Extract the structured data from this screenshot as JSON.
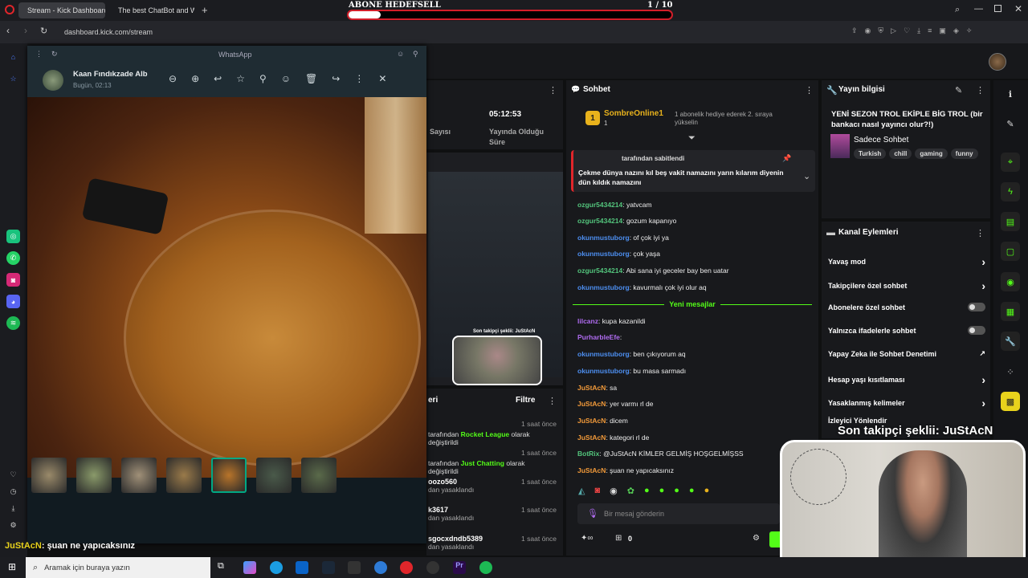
{
  "browser": {
    "tabs": [
      {
        "label": "Stream - Kick Dashboard"
      },
      {
        "label": "The best ChatBot and W"
      }
    ],
    "url": "dashboard.kick.com/stream",
    "goal": {
      "label": "ABONE HEDEFSELL",
      "progress_text": "1 / 10",
      "progress": 0.1
    }
  },
  "whatsapp": {
    "window_title": "WhatsApp",
    "contact_name": "Kaan Fındıkzade Alb",
    "timestamp": "Bugün, 02:13",
    "thumbnail_count": 7,
    "selected_thumbnail": 5
  },
  "stats": {
    "label_left": "Sayısı",
    "uptime": "05:12:53",
    "uptime_label": "Yayında Olduğu Süre"
  },
  "chat": {
    "title": "Sohbet",
    "top_gifter": "SombreOnline1",
    "top_gifter_count": "1",
    "gift_note": "1 abonelik hediye ederek 2. sıraya yükselin",
    "pinned_by": "tarafından sabitlendi",
    "pinned_message": "Çekme dünya nazını kıl beş vakit namazını yarın kılarım diyenin dün kıldık namazını",
    "new_messages_label": "Yeni mesajlar",
    "input_placeholder": "Bir mesaj gönderin",
    "footer_count": "0",
    "messages": [
      {
        "user": "ozgur5434214",
        "text": ": yatvcam",
        "color": "green"
      },
      {
        "user": "ozgur5434214",
        "text": ": gozum kapanıyo",
        "color": "green"
      },
      {
        "user": "okunmustuborg",
        "text": ": of çok iyi ya",
        "color": "blue"
      },
      {
        "user": "okunmustuborg",
        "text": ": çok yaşa",
        "color": "blue"
      },
      {
        "user": "ozgur5434214",
        "text": ": Abi sana iyi geceler bay ben uatar",
        "color": "green"
      },
      {
        "user": "okunmustuborg",
        "text": ": kavurmalı çok iyi olur aq",
        "color": "blue"
      },
      {
        "user": "lilcanz",
        "text": ": kupa kazanildi",
        "color": "purple"
      },
      {
        "user": "PurharbleEfe",
        "text": ":",
        "color": "purple"
      },
      {
        "user": "okunmustuborg",
        "text": ": ben çıkıyorum aq",
        "color": "blue"
      },
      {
        "user": "okunmustuborg",
        "text": ": bu masa sarmadı",
        "color": "blue"
      },
      {
        "user": "JuStAcN",
        "text": ": sa",
        "color": "orange"
      },
      {
        "user": "JuStAcN",
        "text": ": yer varmı rl de",
        "color": "orange"
      },
      {
        "user": "JuStAcN",
        "text": ": dicem",
        "color": "orange"
      },
      {
        "user": "JuStAcN",
        "text": ": kategori rl de",
        "color": "orange"
      },
      {
        "user": "BotRix",
        "text": ": @JuStAcN KİMLER GELMİŞ HOŞGELMİŞSS",
        "color": "green"
      },
      {
        "user": "JuStAcN",
        "text": ": şuan ne yapıcaksınız",
        "color": "orange"
      }
    ]
  },
  "events": {
    "header": "eri",
    "filter_label": "Filtre",
    "items": [
      {
        "prefix": "tarafından",
        "cat": "Rocket League",
        "suffix": "olarak değiştirildi",
        "time": "1 saat önce"
      },
      {
        "prefix": "tarafından",
        "cat": "Just Chatting",
        "suffix": "olarak değiştirildi",
        "time": "1 saat önce"
      },
      {
        "name": "oozo560",
        "sub": "dan yasaklandı",
        "time": "1 saat önce"
      },
      {
        "name": "k3617",
        "sub": "dan yasaklandı",
        "time": "1 saat önce"
      },
      {
        "name": "sgocxdndb5389",
        "sub": "dan yasaklandı",
        "time": "1 saat önce"
      }
    ]
  },
  "stream_info": {
    "title": "Yayın bilgisi",
    "stream_title": "YENİ SEZON TROL EKİPLE BİG TROL (bir bankacı nasıl yayıncı olur?!)",
    "category": "Sadece Sohbet",
    "tags": [
      "Turkish",
      "chill",
      "gaming",
      "funny"
    ]
  },
  "channel_actions": {
    "title": "Kanal Eylemleri",
    "items": [
      {
        "label": "Yavaş mod",
        "kind": "arrow"
      },
      {
        "label": "Takipçilere özel sohbet",
        "kind": "arrow"
      },
      {
        "label": "Abonelere özel sohbet",
        "kind": "toggle"
      },
      {
        "label": "Yalnızca ifadelerle sohbet",
        "kind": "toggle"
      },
      {
        "label": "Yapay Zeka ile Sohbet Denetimi",
        "kind": "link"
      },
      {
        "label": "Hesap yaşı kısıtlaması",
        "kind": "arrow"
      },
      {
        "label": "Yasaklanmış kelimeler",
        "kind": "arrow"
      },
      {
        "label": "İzleyici Yönlendir",
        "kind": "none"
      }
    ]
  },
  "overlay": {
    "last_follower": "Son takipçi şeklii: JuStAcN",
    "small_follower": "Son takipçi şeklii: JuStAcN",
    "chat_echo_user": "JuStAcN",
    "chat_echo_text": ": şuan ne yapıcaksınız"
  },
  "taskbar": {
    "search_placeholder": "Aramak için buraya yazın"
  },
  "colors": {
    "kick_green": "#53fc18",
    "wa_header": "#1f2c33",
    "chat_green": "#53c47c",
    "chat_blue": "#4d8ff1",
    "chat_orange": "#f29a3a"
  }
}
